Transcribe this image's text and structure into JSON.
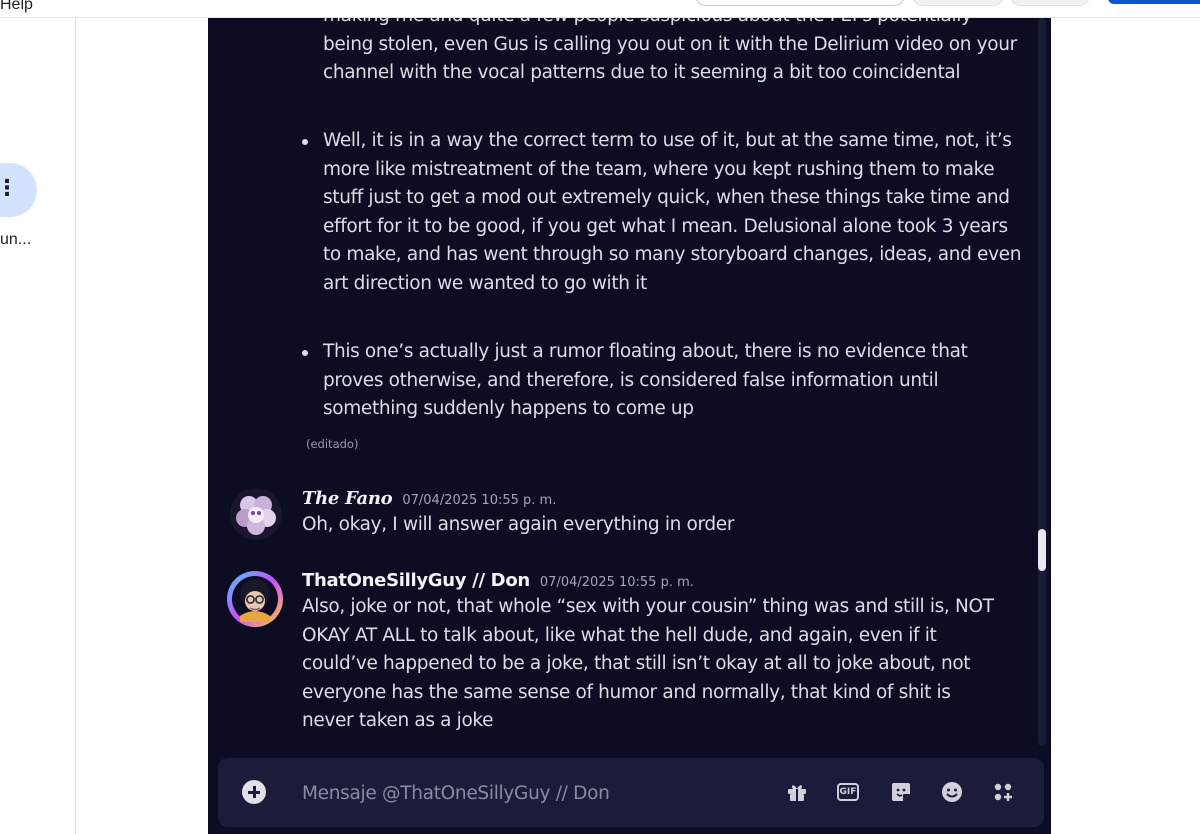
{
  "page": {
    "help_label": "Help",
    "sidebar_truncated_label": "un..."
  },
  "discord": {
    "earlier_message": {
      "continuation_lines": "making me and quite a few people suspicious about the PEPs potentially being stolen, even Gus is calling you out on it with the Delirium video on your channel with the vocal patterns due to it seeming a bit too coincidental",
      "bullets": [
        "Well, it is in a way the correct term to use of it, but at the same time, not, it’s more like mistreatment of the team, where you kept rushing them to make stuff just to get a mod out extremely quick, when these things take time and effort for it to be good, if you get what I mean. Delusional alone took 3 years to make, and has went through so many storyboard changes, ideas, and even art direction we wanted to go with it",
        "This one’s actually just a rumor floating about, there is no evidence that proves otherwise, and therefore, is considered false information until something suddenly happens to come up"
      ],
      "edited_label": "(editado)"
    },
    "messages": [
      {
        "username": "The Fano",
        "timestamp": "07/04/2025 10:55 p. m.",
        "text": "Oh, okay, I will answer again everything in order"
      },
      {
        "username": "ThatOneSillyGuy // Don",
        "timestamp": "07/04/2025 10:55 p. m.",
        "text": "Also, joke or not, that whole “sex with your cousin” thing was and still is, NOT OKAY AT ALL to talk about, like what the hell dude, and again, even if it could’ve happened to be a joke, that still isn’t okay at all to joke about, not everyone has the same sense of humor and normally, that kind of shit is never taken as a joke"
      }
    ],
    "composer": {
      "placeholder": "Mensaje @ThatOneSillyGuy // Don",
      "gif_label": "GIF",
      "icons": [
        "add-attachment-icon",
        "gift-icon",
        "gif-icon",
        "sticker-icon",
        "emoji-icon",
        "apps-icon"
      ]
    },
    "colors": {
      "background": "#0c0d22",
      "composer_bg": "#1b1c3a",
      "text": "#dcdde6",
      "accent": "#0b57d0"
    }
  }
}
